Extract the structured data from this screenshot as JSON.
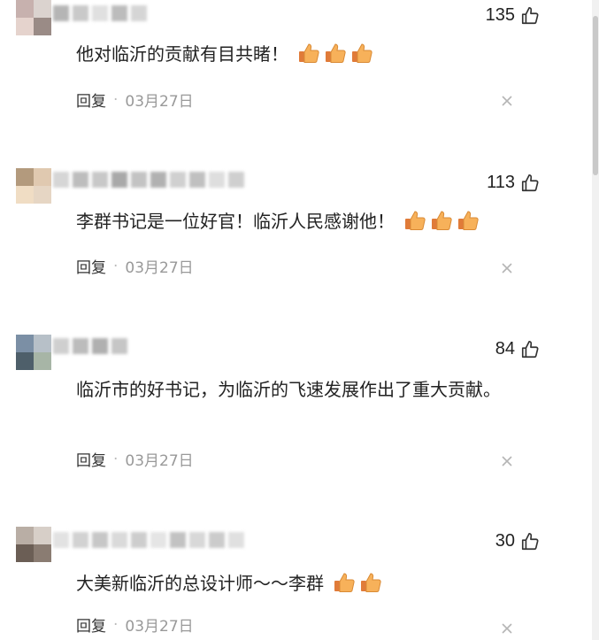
{
  "comments": [
    {
      "likes": "135",
      "text": "他对临沂的贡献有目共睹！",
      "emoji_count": 3,
      "reply_label": "回复",
      "separator": "·",
      "date": "03月27日",
      "avatar_colors": [
        "#c7b1ae",
        "#dbd3cf",
        "#e5d3cd",
        "#9a8b86"
      ]
    },
    {
      "likes": "113",
      "text": "李群书记是一位好官！临沂人民感谢他！",
      "emoji_count": 3,
      "reply_label": "回复",
      "separator": "·",
      "date": "03月27日",
      "avatar_colors": [
        "#b39a7d",
        "#e0c9b0",
        "#f0ddc4",
        "#e6d6c4"
      ]
    },
    {
      "likes": "84",
      "text": "临沂市的好书记，为临沂的飞速发展作出了重大贡献。",
      "emoji_count": 0,
      "reply_label": "回复",
      "separator": "·",
      "date": "03月27日",
      "avatar_colors": [
        "#7b8fa5",
        "#b7c0c8",
        "#4e5f6a",
        "#a7b5a6"
      ]
    },
    {
      "likes": "30",
      "text": "大美新临沂的总设计师～～李群",
      "emoji_count": 2,
      "reply_label": "回复",
      "separator": "·",
      "date": "03月27日",
      "avatar_colors": [
        "#b9aea5",
        "#d7cfc8",
        "#6b5e55",
        "#8a7c72"
      ]
    }
  ],
  "icons": {
    "like": "thumbs-up-outline-icon",
    "emoji": "thumbs-up-emoji-icon",
    "close": "close-icon"
  },
  "colors": {
    "text": "#222222",
    "meta": "#999999",
    "emoji": "#f2a54a"
  }
}
